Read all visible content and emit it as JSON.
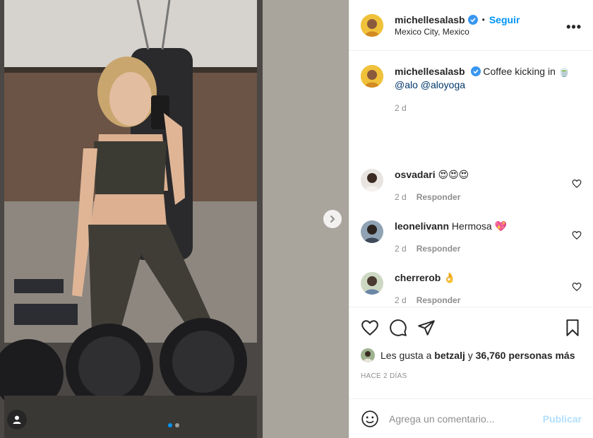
{
  "post": {
    "username": "michellesalasb",
    "follow_label": "Seguir",
    "separator": "•",
    "location": "Mexico City, Mexico",
    "more_label": "•••"
  },
  "caption": {
    "username": "michellesalasb",
    "text": "Coffee kicking in 🍵",
    "mentions": "@alo @aloyoga",
    "time": "2 d"
  },
  "comments": [
    {
      "username": "osvadari",
      "text": "😍😍😍",
      "time": "2 d",
      "reply_label": "Responder"
    },
    {
      "username": "leonelivann",
      "text": "Hermosa 💖",
      "time": "2 d",
      "reply_label": "Responder"
    },
    {
      "username": "cherrerob",
      "text": "👌",
      "time": "2 d",
      "reply_label": "Responder"
    }
  ],
  "likes": {
    "prefix": "Les gusta a",
    "liker": "betzalj",
    "middle": "y",
    "count_text": "36,760 personas más"
  },
  "posted": "HACE 2 DÍAS",
  "add_comment": {
    "placeholder": "Agrega un comentario...",
    "publish_label": "Publicar"
  },
  "carousel": {
    "current": 1,
    "total": 2
  },
  "icons": {
    "like": "heart-icon",
    "comment": "comment-icon",
    "share": "share-icon",
    "save": "bookmark-icon",
    "emoji": "emoji-icon",
    "next": "chevron-right-icon",
    "tag": "user-tag-icon",
    "verified": "verified-badge-icon"
  },
  "colors": {
    "accent": "#0095f6",
    "verified": "#3897f0",
    "muted": "#8e8e8e",
    "link": "#00376b"
  }
}
